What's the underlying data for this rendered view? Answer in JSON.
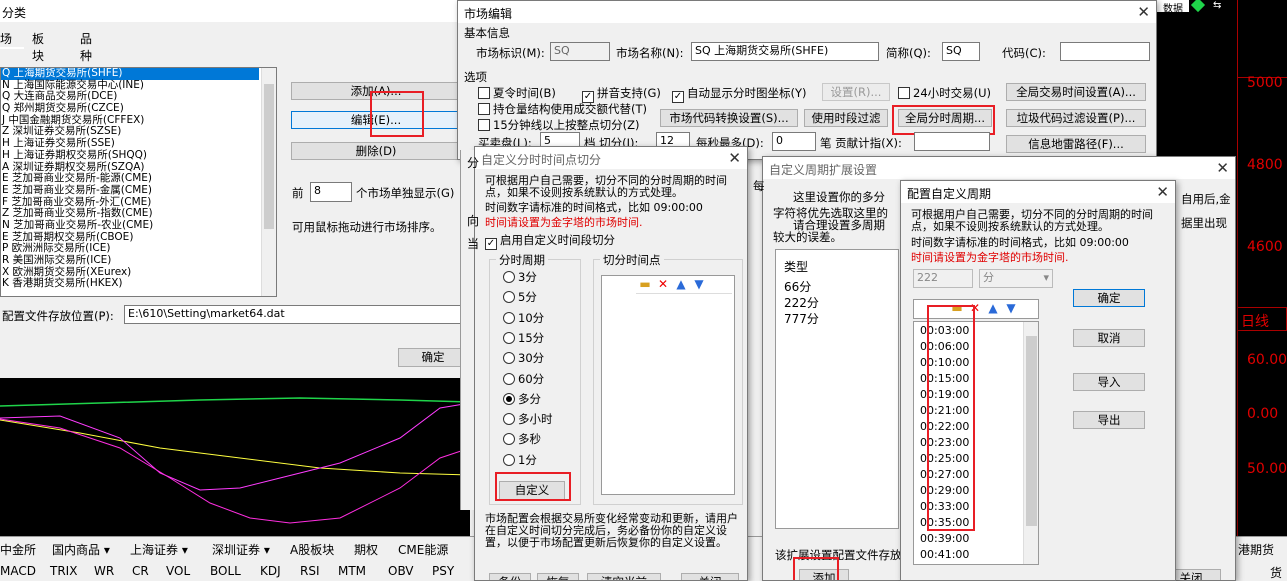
{
  "bg": {
    "title": "分类",
    "tabs": [
      "场",
      "板块",
      "品种"
    ],
    "markets": [
      "Q 上海期货交易所(SHFE)",
      "N 上海国际能源交易中心(INE)",
      "Q 大连商品交易所(DCE)",
      "Q 郑州期货交易所(CZCE)",
      "J 中国金融期货交易所(CFFEX)",
      "Z 深圳证券交易所(SZSE)",
      "H 上海证券交易所(SSE)",
      "H 上海证券期权交易所(SHQQ)",
      "A 深圳证券期权交易所(SZQA)",
      "E 芝加哥商业交易所-能源(CME)",
      "E 芝加哥商业交易所-金属(CME)",
      "F 芝加哥商业交易所-外汇(CME)",
      "Z 芝加哥商业交易所-指数(CME)",
      "N 芝加哥商业交易所-农业(CME)",
      "E 芝加哥期权交易所(CBOE)",
      "P 欧洲洲际交易所(ICE)",
      "R 美国洲际交易所(ICE)",
      "X 欧洲期货交易所(XEurex)",
      "K 香港期货交易所(HKEX)"
    ],
    "add": "添加(A)...",
    "edit": "编辑(E)...",
    "del": "删除(D)",
    "front": "前",
    "front_val": "8",
    "front_suffix": "个市场单独显示(G)",
    "drag_hint": "可用鼠标拖动进行市场排序。",
    "path_label": "配置文件存放位置(P):",
    "path_val": "E:\\610\\Setting\\market64.dat",
    "ok": "确定",
    "right_prices": [
      "5000",
      "4800",
      "4600",
      "60.00",
      "0.00",
      "50.00"
    ],
    "daily": "日线",
    "indicator": "数据",
    "tabs_bottom": [
      "中金所",
      "国内商品 ▾",
      "上海证券 ▾",
      "深圳证券 ▾",
      "A股板块",
      "期权",
      "CME能源",
      "港期货"
    ],
    "indicators": [
      "MACD",
      "TRIX",
      "WR",
      "CR",
      "VOL",
      "BOLL",
      "KDJ",
      "RSI",
      "MTM",
      "OBV",
      "PSY",
      "货"
    ]
  },
  "market": {
    "title": "市场编辑",
    "basic": "基本信息",
    "id_label": "市场标识(M):",
    "id_val": "SQ",
    "name_label": "市场名称(N):",
    "name_val": "SQ 上海期货交易所(SHFE)",
    "short_label": "简称(Q):",
    "short_val": "SQ",
    "code_label": "代码(C):",
    "code_val": "",
    "options": "选项",
    "summer": "夏令时间(B)",
    "pinyin": "拼音支持(G)",
    "autocoord": "自动显示分时图坐标(Y)",
    "setting": "设置(R)...",
    "h24": "24小时交易(U)",
    "global_time": "全局交易时间设置(A)...",
    "hold": "持仓量结构使用成交额代替(T)",
    "code_conv": "市场代码转换设置(S)...",
    "use_period": "使用时段过滤",
    "global_period": "全局分时周期...",
    "garbage": "垃圾代码过滤设置(P)...",
    "min15": "15分钟线以上按整点切分(Z)",
    "buy_label": "买卖盘(L):",
    "buy_val": "5",
    "step_label": "档 切分(I):",
    "step_val": "12",
    "max_label": "每秒最多(D):",
    "max_val": "0",
    "contrib": "笔 贡献计指(X):",
    "minerpath": "信息地雷路径(F)..."
  },
  "split": {
    "title": "自定义分时时间点切分",
    "desc": "可根据用户自己需要，切分不同的分时周期的时间点，如果不设则按系统默认的方式处理。",
    "format": "时间数字请标准的时间格式，比如 09:00:00",
    "red": "时间请设置为金字塔的市场时间.",
    "enable": "启用自定义时间段切分",
    "period_grp": "分时周期",
    "point_grp": "切分时间点",
    "radios": [
      "3分",
      "5分",
      "10分",
      "15分",
      "30分",
      "60分",
      "多分",
      "多小时",
      "多秒",
      "1分"
    ],
    "custom": "自定义",
    "note": "市场配置会根据交易所变化经常变动和更新，请用户在自定义时间切分完成后，务必备份你的自定义设置，以便于市场配置更新后恢复你的自定义设置。",
    "backup": "备份",
    "restore": "恢复",
    "clear": "清空当前",
    "close": "关闭",
    "partial": [
      "分",
      "向",
      "当"
    ]
  },
  "ext": {
    "title": "自定义周期扩展设置",
    "line1": "这里设置你的多分",
    "line2": "字符将优先选取这里的",
    "line3": "请合理设置多周期",
    "line4": "较大的误差。",
    "right1": "自用后,金",
    "right2": "据里出现",
    "type": "类型",
    "items": [
      "66分",
      "222分",
      "777分"
    ],
    "bottom_note": "该扩展设置配置文件存放",
    "add": "添加",
    "close": "关闭",
    "mei": "每"
  },
  "cfg": {
    "title": "配置自定义周期",
    "desc": "可根据用户自己需要，切分不同的分时周期的时间点，如果不设则按系统默认的方式处理。",
    "format": "时间数字请标准的时间格式，比如 09:00:00",
    "red": "时间请设置为金字塔的市场时间.",
    "period_val": "222",
    "unit_val": "分",
    "times": [
      "00:03:00",
      "00:06:00",
      "00:10:00",
      "00:15:00",
      "00:19:00",
      "00:21:00",
      "00:22:00",
      "00:23:00",
      "00:25:00",
      "00:27:00",
      "00:29:00",
      "00:33:00",
      "00:35:00",
      "00:39:00",
      "00:41:00"
    ],
    "ok": "确定",
    "cancel": "取消",
    "import": "导入",
    "export": "导出"
  }
}
